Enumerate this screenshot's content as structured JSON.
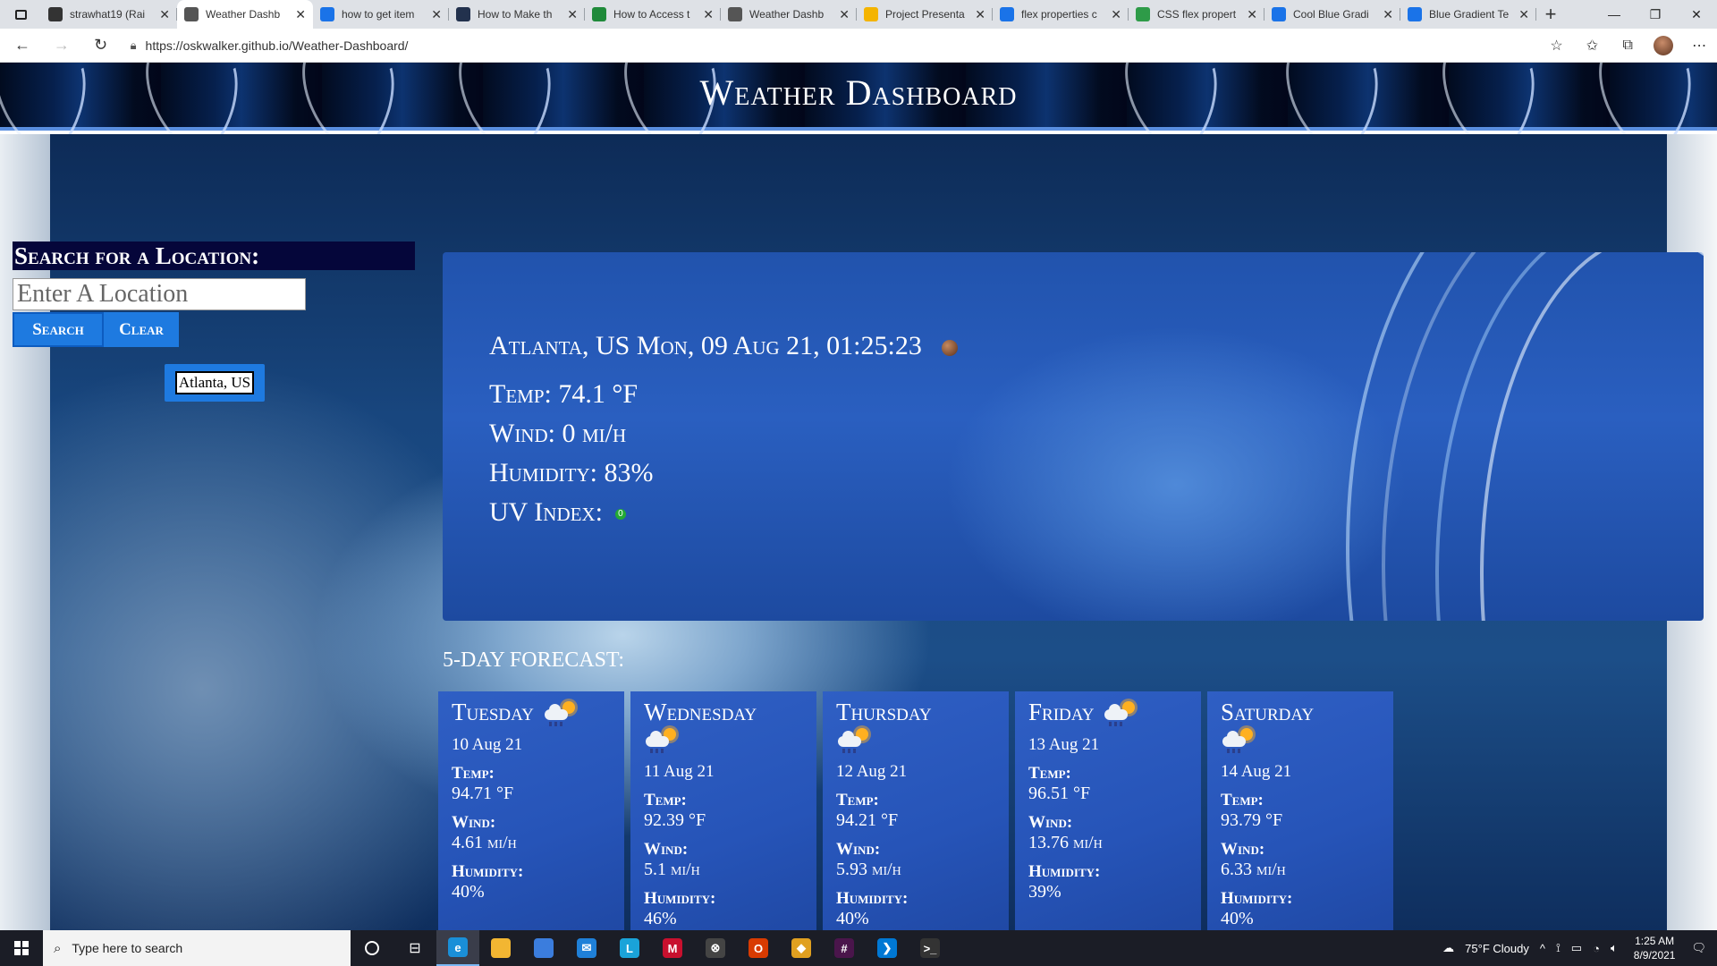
{
  "browser": {
    "tabs": [
      {
        "title": "strawhat19 (Rai",
        "favicon": "github-icon",
        "color": "#333333"
      },
      {
        "title": "Weather Dashb",
        "favicon": "page-icon",
        "color": "#555555",
        "active": true
      },
      {
        "title": "how to get item",
        "favicon": "bing-icon",
        "color": "#1a73e8"
      },
      {
        "title": "How to Make th",
        "favicon": "site-icon",
        "color": "#22314d"
      },
      {
        "title": "How to Access t",
        "favicon": "dp-icon",
        "color": "#1f8a3a"
      },
      {
        "title": "Weather Dashb",
        "favicon": "page-icon",
        "color": "#555555"
      },
      {
        "title": "Project Presenta",
        "favicon": "slides-icon",
        "color": "#f4b400"
      },
      {
        "title": "flex properties c",
        "favicon": "bing-icon",
        "color": "#1a73e8"
      },
      {
        "title": "CSS flex propert",
        "favicon": "w3-icon",
        "color": "#2e9b48"
      },
      {
        "title": "Cool Blue Gradi",
        "favicon": "bing-icon",
        "color": "#1a73e8"
      },
      {
        "title": "Blue Gradient Te",
        "favicon": "bing-icon",
        "color": "#1a73e8"
      }
    ],
    "url": "https://oskwalker.github.io/Weather-Dashboard/"
  },
  "site": {
    "title": "Weather Dashboard"
  },
  "search": {
    "heading": "Search for a Location:",
    "placeholder": "Enter A Location",
    "search_label": "Search",
    "clear_label": "Clear",
    "history": [
      "Atlanta, US"
    ]
  },
  "current": {
    "city_date": "Atlanta, US Mon, 09 Aug 21, 01:25:23",
    "temp": "Temp: 74.1 °F",
    "wind": "Wind: 0 mi/h",
    "humidity": "Humidity: 83%",
    "uv_label": "UV Index:",
    "uv_value": "0",
    "uv_color": "#22aa33",
    "icon": "moon-icon"
  },
  "forecast": {
    "heading": "5-DAY FORECAST:",
    "temp_label": "Temp:",
    "wind_label": "Wind:",
    "humidity_label": "Humidity:",
    "days": [
      {
        "day": "Tuesday",
        "date": "10 Aug 21",
        "temp": "94.71 °F",
        "wind": "4.61",
        "humidity": "40%",
        "icon": "rain-sun-icon"
      },
      {
        "day": "Wednesday",
        "date": "11 Aug 21",
        "temp": "92.39 °F",
        "wind": "5.1",
        "humidity": "46%",
        "icon": "rain-sun-icon"
      },
      {
        "day": "Thursday",
        "date": "12 Aug 21",
        "temp": "94.21 °F",
        "wind": "5.93",
        "humidity": "40%",
        "icon": "rain-sun-icon"
      },
      {
        "day": "Friday",
        "date": "13 Aug 21",
        "temp": "96.51 °F",
        "wind": "13.76",
        "humidity": "39%",
        "icon": "rain-sun-icon"
      },
      {
        "day": "Saturday",
        "date": "14 Aug 21",
        "temp": "93.79 °F",
        "wind": "6.33",
        "humidity": "40%",
        "icon": "rain-sun-icon"
      }
    ],
    "wind_unit": "mi/h"
  },
  "taskbar": {
    "search_placeholder": "Type here to search",
    "weather": "75°F  Cloudy",
    "time": "1:25 AM",
    "date": "8/9/2021",
    "apps": [
      {
        "name": "edge-icon",
        "color": "#1a8fd8",
        "glyph": "e",
        "active": true
      },
      {
        "name": "file-explorer-icon",
        "color": "#f2b632",
        "glyph": ""
      },
      {
        "name": "store-icon",
        "color": "#3b7ddd",
        "glyph": ""
      },
      {
        "name": "mail-icon",
        "color": "#1f80d8",
        "glyph": "✉"
      },
      {
        "name": "l-app-icon",
        "color": "#1aa3d9",
        "glyph": "L"
      },
      {
        "name": "mcafee-icon",
        "color": "#c8102e",
        "glyph": "M"
      },
      {
        "name": "xbox-icon",
        "color": "#444444",
        "glyph": "⊗"
      },
      {
        "name": "office-icon",
        "color": "#d83b01",
        "glyph": "O"
      },
      {
        "name": "git-icon",
        "color": "#e0a020",
        "glyph": "◆"
      },
      {
        "name": "slack-icon",
        "color": "#4a154b",
        "glyph": "#"
      },
      {
        "name": "vscode-icon",
        "color": "#0078d4",
        "glyph": "❯"
      },
      {
        "name": "terminal-icon",
        "color": "#333333",
        "glyph": ">_"
      }
    ]
  }
}
